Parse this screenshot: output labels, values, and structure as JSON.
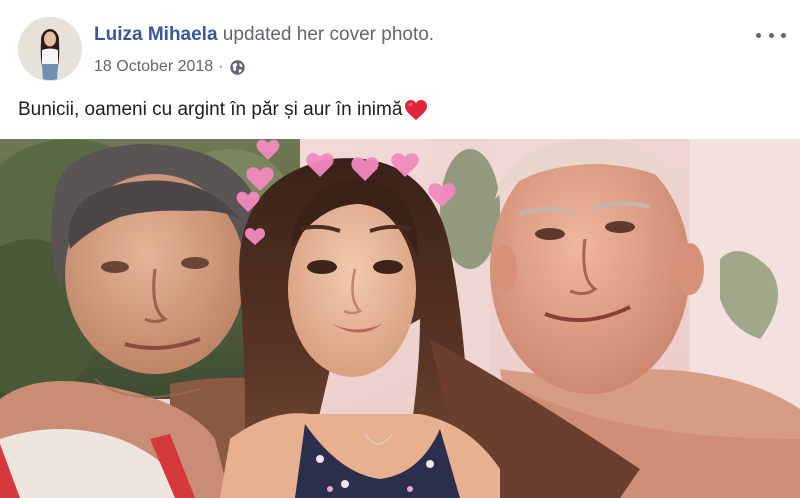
{
  "post": {
    "author_name": "Luiza Mihaela",
    "action_text": " updated her cover photo.",
    "date": "18 October 2018",
    "separator": "·",
    "privacy_icon": "globe-icon",
    "more_icon": "more-options-icon",
    "text": "Bunicii, oameni cu argint în păr și aur în inimă",
    "text_emoji": "red-heart-emoji",
    "photo_icon": "cover-photo"
  },
  "colors": {
    "author_link": "#385898",
    "secondary_text": "#616770",
    "body_text": "#1c1e21",
    "heart": "#e0243a"
  }
}
